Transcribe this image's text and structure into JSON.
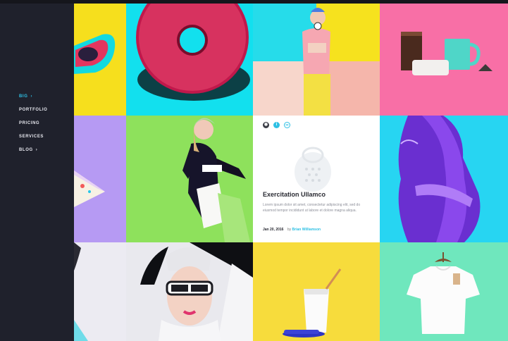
{
  "nav": {
    "items": [
      {
        "label": "BIG",
        "chevron": "›"
      },
      {
        "label": "PORTFOLIO",
        "chevron": ""
      },
      {
        "label": "PRICING",
        "chevron": ""
      },
      {
        "label": "SERVICES",
        "chevron": ""
      },
      {
        "label": "BLOG",
        "chevron": "›"
      }
    ]
  },
  "card": {
    "title": "Exercitation Ullamco",
    "excerpt": "Lorem ipsum dolor sit amet, consectetur adipiscing elit, sed do eiusmod tempor incididunt ut labore et dolore magna aliqua.",
    "date": "Jan 20, 2016",
    "by": "by",
    "author": "Brian Williamson",
    "icons": [
      "camera-icon",
      "info-icon",
      "link-icon"
    ]
  },
  "colors": {
    "sidebar": "#1f212c",
    "accent": "#2ec0e4"
  }
}
